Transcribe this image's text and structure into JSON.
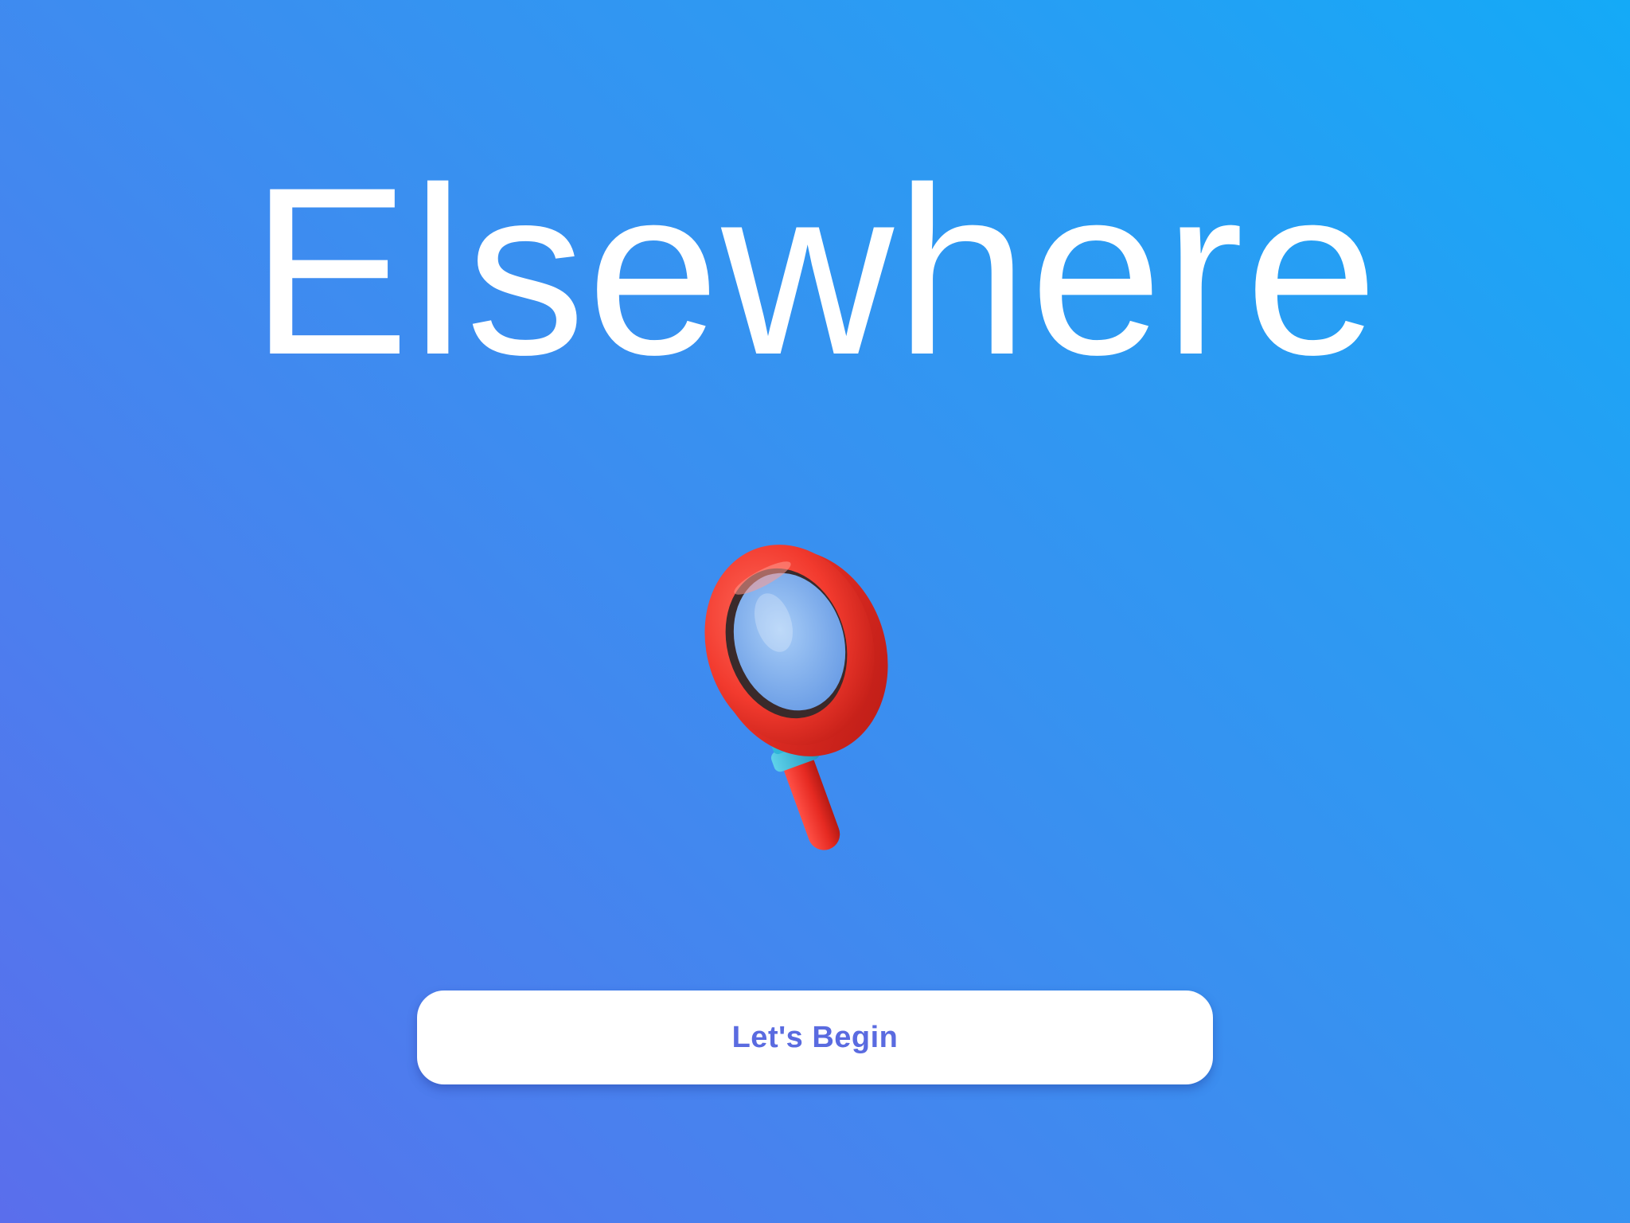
{
  "app": {
    "title": "Elsewhere"
  },
  "hero": {
    "icon": "magnifying-glass-icon",
    "ring_color": "#f23a2e",
    "collar_color": "#2fb6d8",
    "lens_color": "#8fb9f2"
  },
  "actions": {
    "begin_label": "Let's Begin"
  },
  "colors": {
    "background_start": "#5a6eec",
    "background_end": "#14aaf7",
    "button_text": "#5a6be0",
    "title_text": "#ffffff"
  }
}
